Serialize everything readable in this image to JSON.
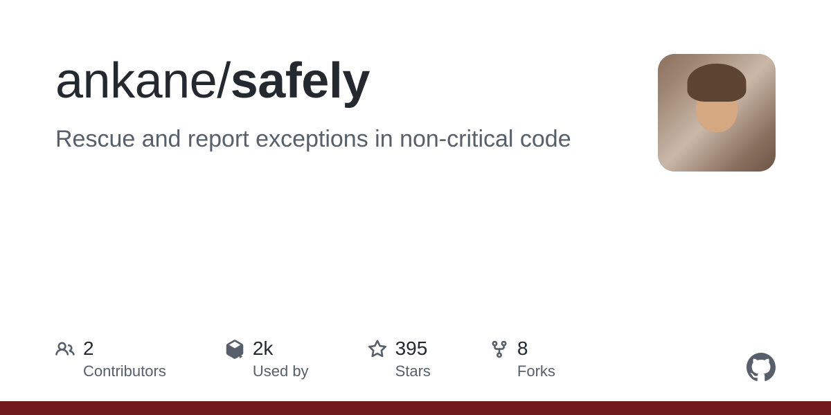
{
  "repo": {
    "owner": "ankane",
    "separator": "/",
    "name": "safely",
    "description": "Rescue and report exceptions in non-critical code"
  },
  "stats": {
    "contributors": {
      "value": "2",
      "label": "Contributors"
    },
    "usedby": {
      "value": "2k",
      "label": "Used by"
    },
    "stars": {
      "value": "395",
      "label": "Stars"
    },
    "forks": {
      "value": "8",
      "label": "Forks"
    }
  }
}
